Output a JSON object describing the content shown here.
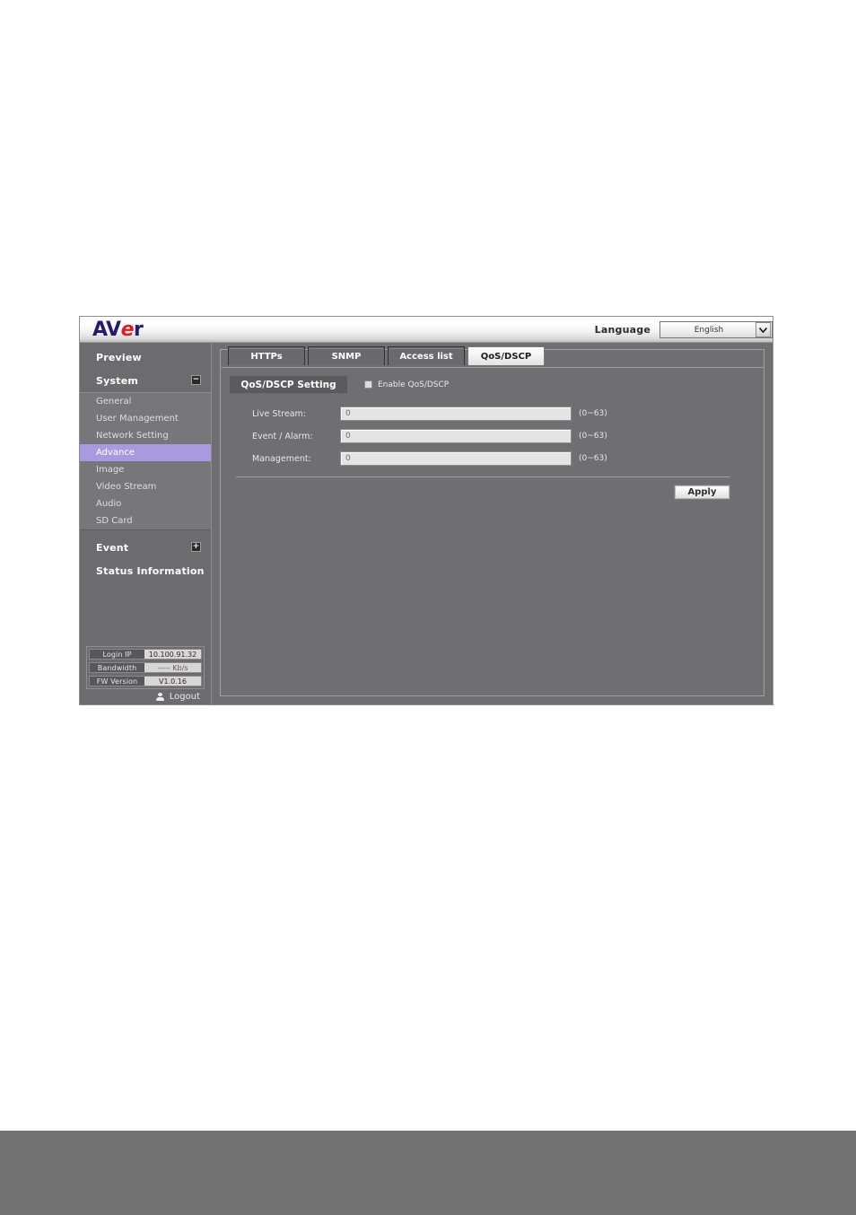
{
  "header": {
    "logo_blue_1": "AV",
    "logo_red": "e",
    "logo_blue_2": "r",
    "language_label": "Language",
    "language_value": "English",
    "dropdown_arrow": "⌄"
  },
  "sidebar": {
    "sections": [
      {
        "label": "Preview",
        "toggle": ""
      },
      {
        "label": "System",
        "toggle": "−"
      }
    ],
    "items": [
      {
        "label": "General",
        "active": false
      },
      {
        "label": "User Management",
        "active": false
      },
      {
        "label": "Network Setting",
        "active": false
      },
      {
        "label": "Advance",
        "active": true
      },
      {
        "label": "Image",
        "active": false
      },
      {
        "label": "Video Stream",
        "active": false
      },
      {
        "label": "Audio",
        "active": false
      },
      {
        "label": "SD Card",
        "active": false
      }
    ],
    "section_event": {
      "label": "Event",
      "toggle": "+"
    },
    "section_status": {
      "label": "Status Information"
    },
    "status": [
      {
        "key": "Login IP",
        "value": "10.100.91.32"
      },
      {
        "key": "Bandwidth",
        "value": "----- Kb/s"
      },
      {
        "key": "FW Version",
        "value": "V1.0.16"
      }
    ],
    "logout_label": "Logout"
  },
  "tabs": [
    {
      "label": "HTTPs",
      "active": false
    },
    {
      "label": "SNMP",
      "active": false
    },
    {
      "label": "Access list",
      "active": false
    },
    {
      "label": "QoS/DSCP",
      "active": true
    }
  ],
  "panel": {
    "section_button": "QoS/DSCP Setting",
    "enable_checkbox_label": "Enable QoS/DSCP",
    "enable_checked": false,
    "fields": [
      {
        "label": "Live Stream:",
        "value": "0",
        "hint": "(0~63)"
      },
      {
        "label": "Event / Alarm:",
        "value": "0",
        "hint": "(0~63)"
      },
      {
        "label": "Management:",
        "value": "0",
        "hint": "(0~63)"
      }
    ],
    "apply_label": "Apply"
  },
  "colors": {
    "accent_active_nav": "#a99ae0",
    "app_bg": "#6f6f71",
    "sidebar_bg": "#6c6c6e",
    "logo_blue": "#221b6e",
    "logo_red": "#d2232a",
    "page_band": "#727272"
  }
}
